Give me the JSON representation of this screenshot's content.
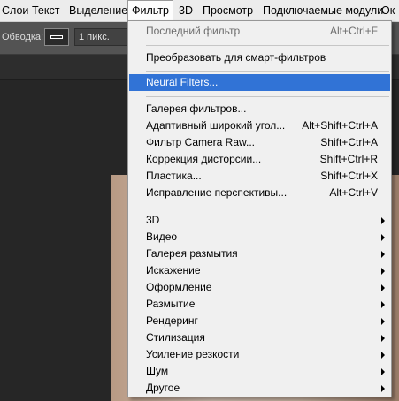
{
  "menubar": {
    "items": [
      "Слои",
      "Текст",
      "Выделение",
      "Фильтр",
      "3D",
      "Просмотр",
      "Подключаемые модули",
      "Ок"
    ]
  },
  "options": {
    "stroke_label": "Обводка:",
    "stroke_width": "1 пикс."
  },
  "filter_menu": {
    "last_filter": {
      "label": "Последний фильтр",
      "shortcut": "Alt+Ctrl+F"
    },
    "smart": {
      "label": "Преобразовать для смарт-фильтров"
    },
    "neural": {
      "label": "Neural Filters..."
    },
    "gallery": {
      "label": "Галерея фильтров..."
    },
    "adaptive": {
      "label": "Адаптивный широкий угол...",
      "shortcut": "Alt+Shift+Ctrl+A"
    },
    "camera_raw": {
      "label": "Фильтр Camera Raw...",
      "shortcut": "Shift+Ctrl+A"
    },
    "lens": {
      "label": "Коррекция дисторсии...",
      "shortcut": "Shift+Ctrl+R"
    },
    "liquify": {
      "label": "Пластика...",
      "shortcut": "Shift+Ctrl+X"
    },
    "vanishing": {
      "label": "Исправление перспективы...",
      "shortcut": "Alt+Ctrl+V"
    },
    "submenus": [
      "3D",
      "Видео",
      "Галерея размытия",
      "Искажение",
      "Оформление",
      "Размытие",
      "Рендеринг",
      "Стилизация",
      "Усиление резкости",
      "Шум",
      "Другое"
    ]
  }
}
